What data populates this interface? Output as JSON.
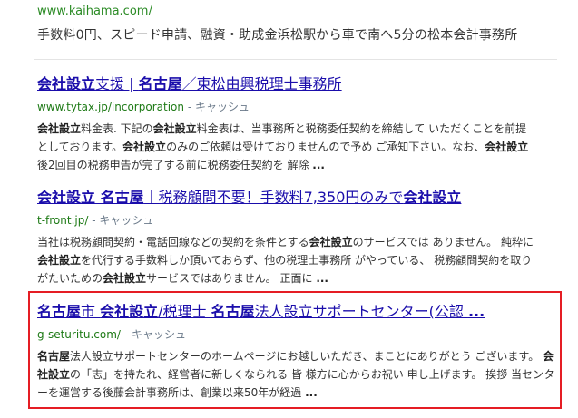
{
  "ad": {
    "url": "www.kaihama.com/",
    "description": "手数料0円、スピード申請、融資・助成金浜松駅から車で南へ5分の松本会計事務所"
  },
  "results": [
    {
      "title_parts": [
        {
          "text": "会社設立",
          "bold": true
        },
        {
          "text": "支援 | ",
          "bold": false
        },
        {
          "text": "名古屋",
          "bold": true
        },
        {
          "text": "／東松由興税理士事務所",
          "bold": false
        }
      ],
      "url": "www.tytax.jp/incorporation",
      "cache_label": "キャッシュ",
      "snippet_lines": [
        [
          {
            "t": "会社設立",
            "b": true
          },
          {
            "t": "料金表. 下記の",
            "b": false
          },
          {
            "t": "会社設立",
            "b": true
          },
          {
            "t": "料金表は、当事務所と税務委任契約を締結して いただくことを前提",
            "b": false
          }
        ],
        [
          {
            "t": "としております。",
            "b": false
          },
          {
            "t": "会社設立",
            "b": true
          },
          {
            "t": "のみのご依頼は受けておりませんので予め ご承知下さい。なお、",
            "b": false
          },
          {
            "t": "会社設立",
            "b": true
          }
        ],
        [
          {
            "t": "後2回目の税務申告が完了する前に税務委任契約を 解除 ",
            "b": false
          },
          {
            "t": "...",
            "b": true
          }
        ]
      ]
    },
    {
      "title_parts": [
        {
          "text": "会社設立 名古屋",
          "bold": true
        },
        {
          "text": "｜税務顧問不要！手数料7,350円のみで",
          "bold": false
        },
        {
          "text": "会社設立",
          "bold": true
        }
      ],
      "url": "t-front.jp/",
      "cache_label": "キャッシュ",
      "snippet_lines": [
        [
          {
            "t": "当社は税務顧問契約・電話回線などの契約を条件とする",
            "b": false
          },
          {
            "t": "会社設立",
            "b": true
          },
          {
            "t": "のサービスでは ありません。 純粋に",
            "b": false
          }
        ],
        [
          {
            "t": "会社設立",
            "b": true
          },
          {
            "t": "を代行する手数料しか頂いておらず、他の税理士事務所 がやっている、 税務顧問契約を取り",
            "b": false
          }
        ],
        [
          {
            "t": "がたいための",
            "b": false
          },
          {
            "t": "会社設立",
            "b": true
          },
          {
            "t": "サービスではありません。 正面に ",
            "b": false
          },
          {
            "t": "...",
            "b": true
          }
        ]
      ]
    },
    {
      "title_parts": [
        {
          "text": "名古屋",
          "bold": true
        },
        {
          "text": "市 ",
          "bold": false
        },
        {
          "text": "会社設立",
          "bold": true
        },
        {
          "text": "/税理士 ",
          "bold": false
        },
        {
          "text": "名古屋",
          "bold": true
        },
        {
          "text": "法人設立サポートセンター(公認 ",
          "bold": false
        },
        {
          "text": "...",
          "bold": true
        }
      ],
      "url": "g-seturitu.com/",
      "cache_label": "キャッシュ",
      "snippet_lines": [
        [
          {
            "t": "名古屋",
            "b": true
          },
          {
            "t": "法人設立サポートセンターのホームページにお越しいただき、まことにありがとう ございます。 ",
            "b": false
          },
          {
            "t": "会",
            "b": true
          }
        ],
        [
          {
            "t": "社設立",
            "b": true
          },
          {
            "t": "の「志」を持たれ、経営者に新しくなられる 皆 様方に心からお祝い 申し上げます。 挨拶 当センタ",
            "b": false
          }
        ],
        [
          {
            "t": "ーを運営する後藤会計事務所は、創業以来50年が経過 ",
            "b": false
          },
          {
            "t": "...",
            "b": true
          }
        ]
      ]
    }
  ],
  "colors": {
    "title": "#1a0dab",
    "url": "#1e7a16",
    "highlight": "#e51d24"
  }
}
